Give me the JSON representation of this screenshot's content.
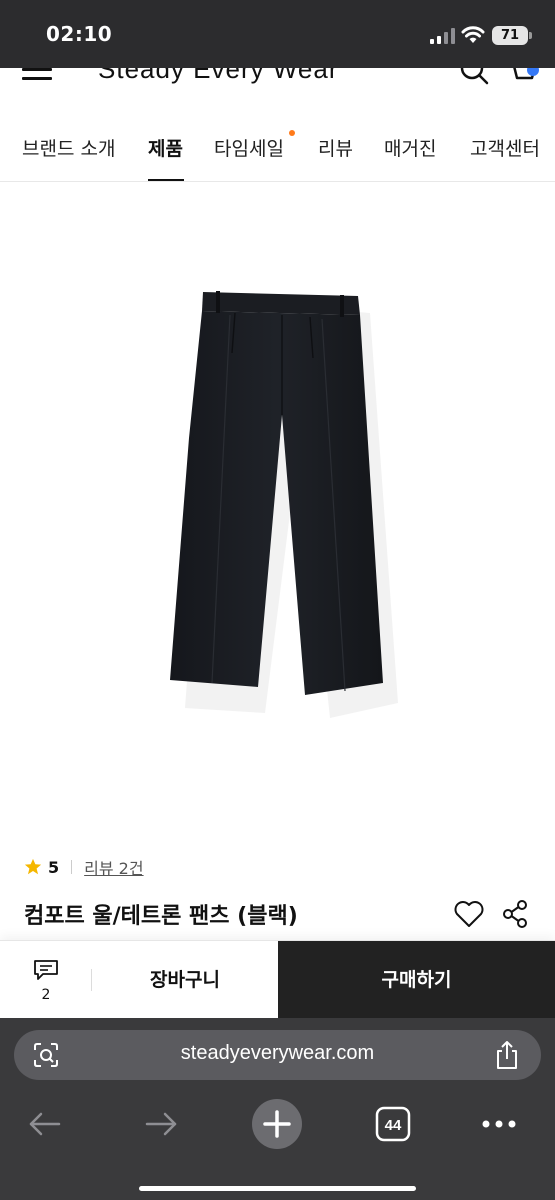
{
  "status_bar": {
    "time": "02:10",
    "battery": "71"
  },
  "site": {
    "logo": "Steady Every Wear",
    "brand_color": "#3478f6"
  },
  "nav": {
    "tabs": [
      {
        "label": "브랜드 소개",
        "active": false
      },
      {
        "label": "제품",
        "active": true
      },
      {
        "label": "타임세일",
        "active": false,
        "badge_color": "#ff7a1a"
      },
      {
        "label": "리뷰",
        "active": false
      },
      {
        "label": "매거진",
        "active": false
      },
      {
        "label": "고객센터",
        "active": false
      }
    ]
  },
  "product": {
    "image_alt": "pants",
    "rating": "5",
    "review_link": "리뷰 2건",
    "title": "컴포트 울/테트론 팬츠 (블랙)"
  },
  "purchase_bar": {
    "comment_count": "2",
    "cart_label": "장바구니",
    "buy_label": "구매하기",
    "buy_color": "#222222"
  },
  "browser": {
    "url": "steadyeverywear.com",
    "tab_count": "44"
  }
}
